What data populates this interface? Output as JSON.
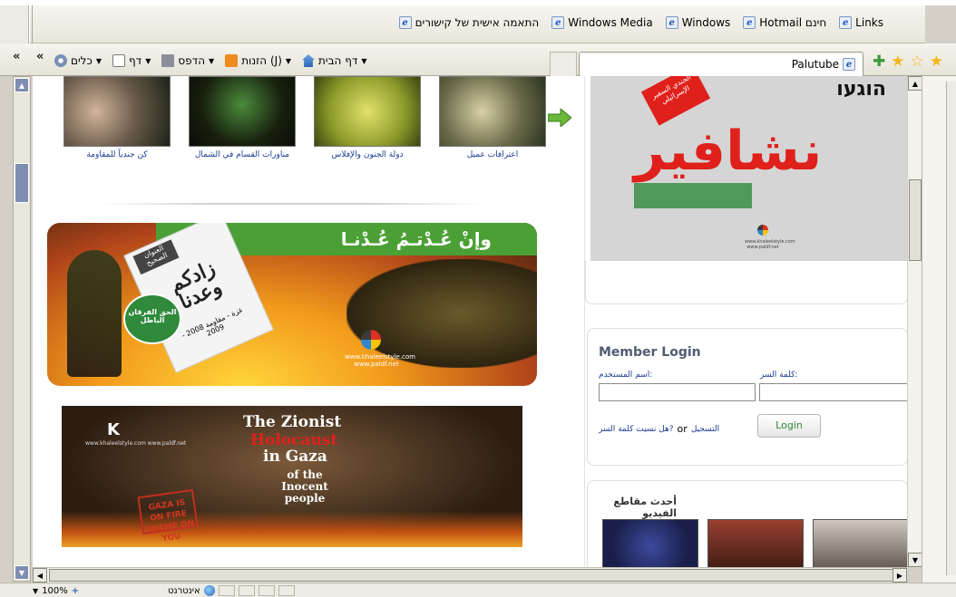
{
  "links_bar": {
    "items": [
      {
        "label": "Links"
      },
      {
        "label": "Hotmail חינם"
      },
      {
        "label": "Windows"
      },
      {
        "label": "Windows Media"
      },
      {
        "label": "התאמה אישית של קישורים"
      }
    ]
  },
  "command_bar": {
    "chevron_left": "«",
    "chevron_right": "«",
    "home": "דף הבית",
    "feeds": "הזנות (J)",
    "print": "הדפס",
    "page": "דף",
    "tools": "כלים"
  },
  "tab": {
    "title": "Palutube"
  },
  "colors": {
    "accent_green": "#2f8a3c",
    "accent_red": "#e0201a",
    "link_blue": "#1a3b94"
  },
  "videos_row": {
    "items": [
      {
        "caption": "اعترافات عميل"
      },
      {
        "caption": "دولة الجنون والإفلاس"
      },
      {
        "caption": "مناورات القسام في الشمال"
      },
      {
        "caption": "كن جندياً للمقاومة"
      }
    ],
    "next_icon": "green-arrow-right"
  },
  "banner1": {
    "headline": "وإنْ عُـدْتـمُ عُـدْنـا",
    "card_tag": "العنوان الصحيح",
    "card_title": "زادكم وعدنا",
    "card_sub": "غزة - مقاومة 2008 - 2009",
    "badge": "الحق الفرقان الباطل",
    "urls": "www.khaleelstyle.com www.paldf.net"
  },
  "banner2": {
    "logo": "K",
    "urls": "www.khaleelstyle.com www.paldf.net",
    "title_line1": "The Zionist",
    "title_line2": "Holocaust",
    "title_line3": "in Gaza",
    "title_line4": "of the Inocent people",
    "stamp": "GAZA IS ON FIRE SHAME ON YOU"
  },
  "promo": {
    "heb_text": "הוגעו",
    "red_tag": "الجندي السفير الإسرائيلي",
    "big_text": "نشافير",
    "urls": "www.khaleelstyle.com www.paldf.net"
  },
  "login": {
    "title": "Member Login",
    "username_label": ":اسم المستخدم",
    "password_label": ":كلمة السر",
    "forgot": "?هل نسيت كلمة السر",
    "or": "or",
    "register": "التسجيل",
    "button": "Login"
  },
  "latest_videos": {
    "title": "أحدث مقاطع الفيديو"
  },
  "status_bar": {
    "zoom": "100%",
    "zone": "אינטרנט"
  }
}
